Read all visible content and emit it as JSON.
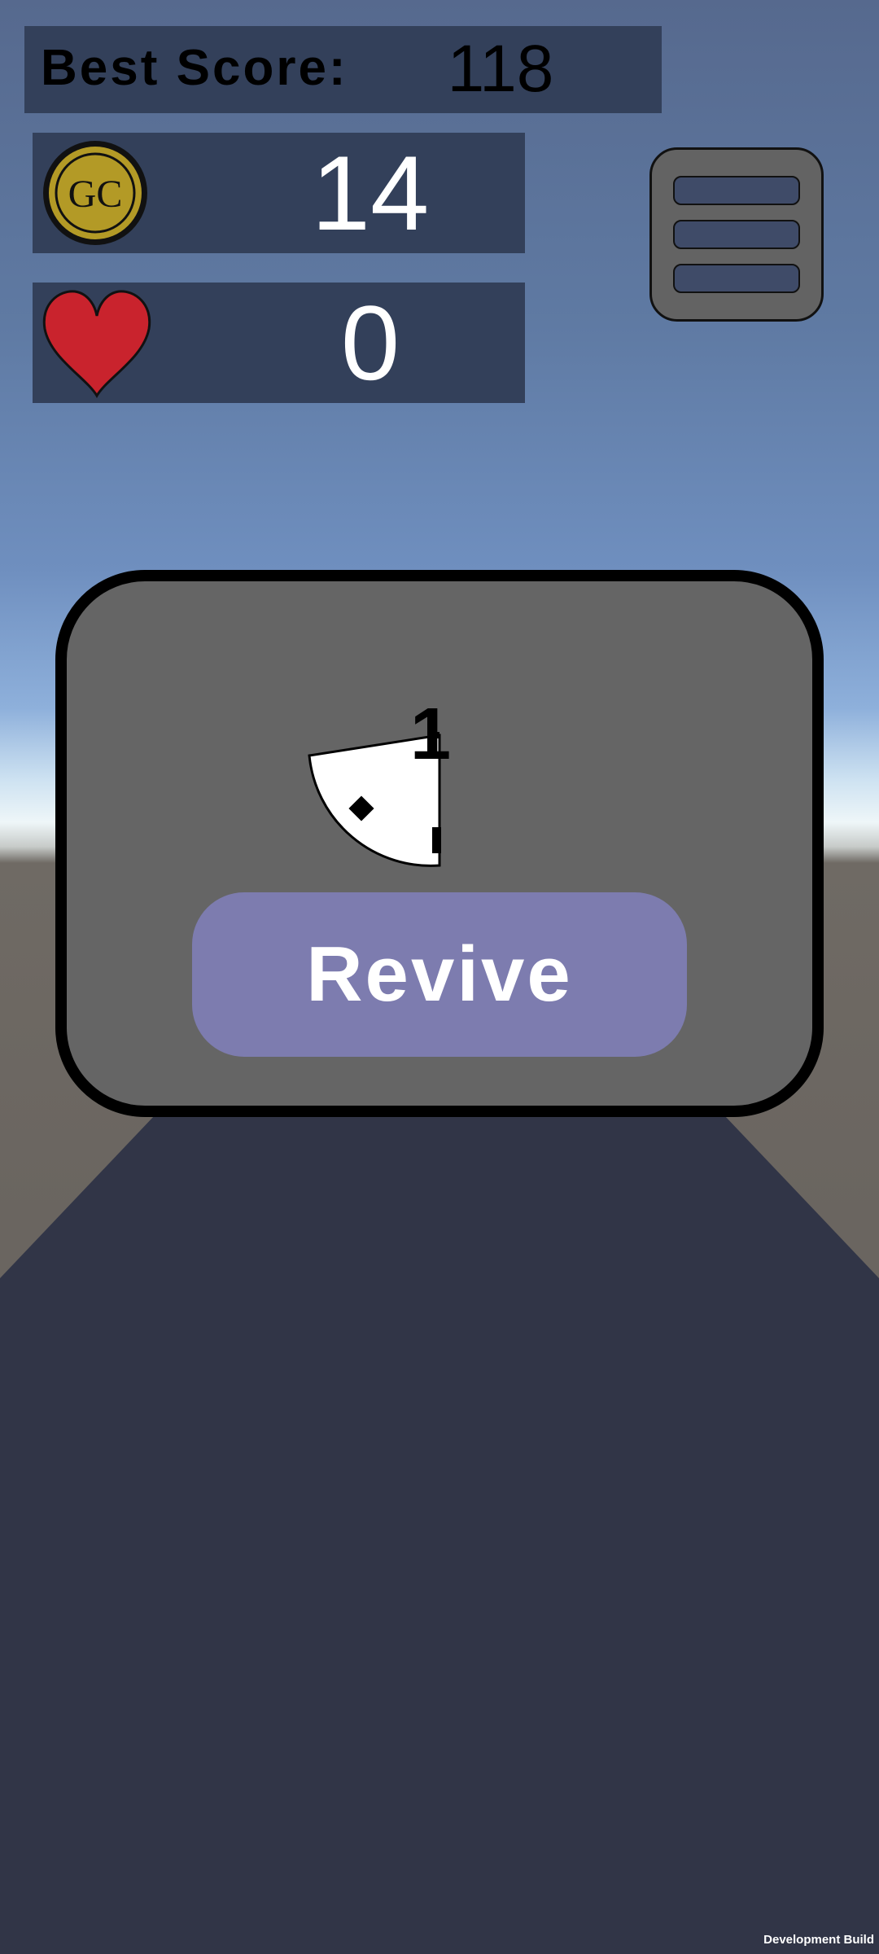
{
  "hud": {
    "best_score_label": "Best Score:",
    "best_score_value": "118",
    "coins": "14",
    "lives": "0",
    "coin_icon_text": "GC"
  },
  "revive_dialog": {
    "countdown": "1",
    "revive_label": "Revive"
  },
  "footer": {
    "build_label": "Development Build"
  },
  "icons": {
    "coin": "gold-coin-icon",
    "heart": "heart-icon",
    "menu": "hamburger-menu-icon",
    "timer": "countdown-timer-icon"
  },
  "colors": {
    "panel": "#33405a",
    "dialog": "#656565",
    "revive_button": "#7d7caf",
    "coin_gold": "#b39a26",
    "heart_red": "#c9232d",
    "road": "#313547"
  }
}
